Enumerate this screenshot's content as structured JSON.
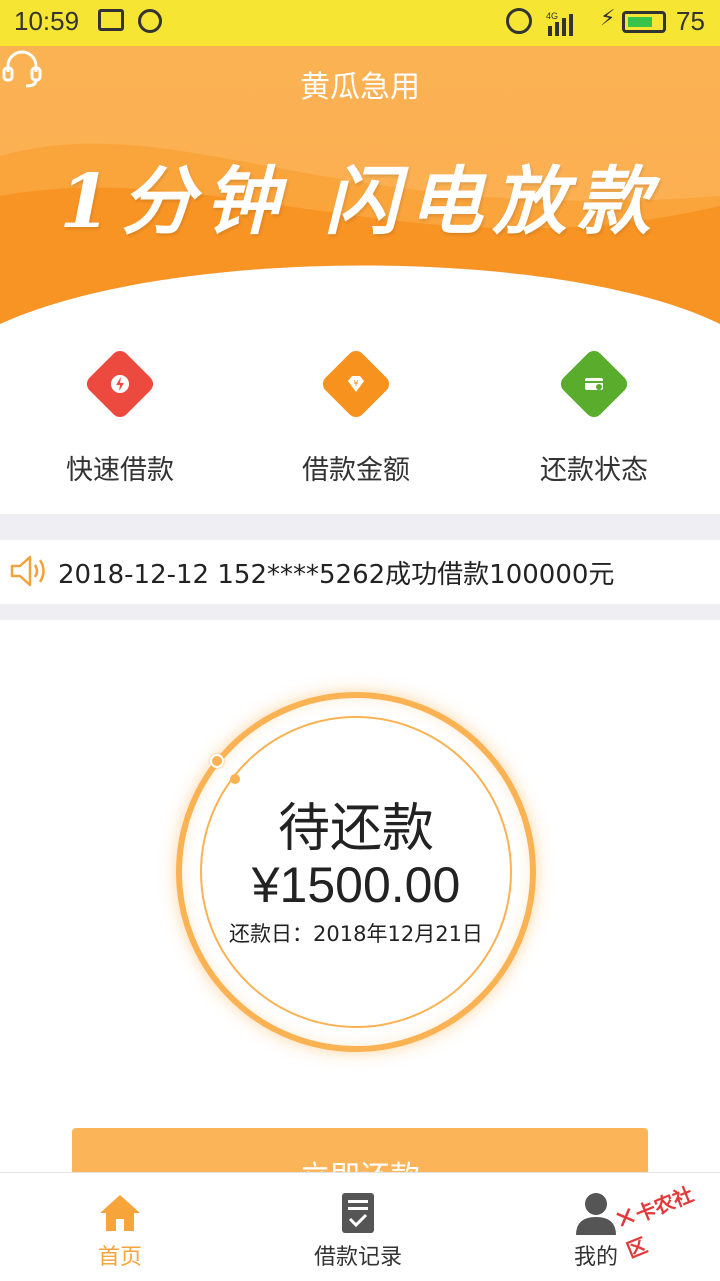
{
  "status_bar": {
    "time": "10:59",
    "network": "4G",
    "battery_percent": "75",
    "battery_level": 0.75,
    "battery_color": "#39c34a",
    "icons": [
      "mail-icon",
      "check-circle-icon",
      "alarm-icon",
      "signal-icon",
      "charging-icon",
      "battery-icon"
    ]
  },
  "header": {
    "title": "黄瓜急用",
    "support_icon": "headset-icon",
    "brand_color": "#fbb253"
  },
  "banner": {
    "slogan": "1分钟 闪电放款"
  },
  "features": [
    {
      "label": "快速借款",
      "icon": "lightning-icon",
      "color": "#ec4a3e"
    },
    {
      "label": "借款金额",
      "icon": "diamond-yen-icon",
      "color": "#f7921e"
    },
    {
      "label": "还款状态",
      "icon": "card-check-icon",
      "color": "#5aac2d"
    }
  ],
  "notice": {
    "icon": "speaker-icon",
    "text": "2018-12-12 152****5262成功借款100000元"
  },
  "loan_card": {
    "status_label": "待还款",
    "amount": "¥1500.00",
    "due_date": "还款日：2018年12月21日"
  },
  "repay_button": {
    "label": "立即还款"
  },
  "tabbar": {
    "items": [
      {
        "label": "首页",
        "icon": "home-icon",
        "active": true
      },
      {
        "label": "借款记录",
        "icon": "record-icon",
        "active": false
      },
      {
        "label": "我的",
        "icon": "user-icon",
        "active": false
      }
    ],
    "active_color": "#f7a43a"
  },
  "watermark": {
    "text": "卡农社区"
  }
}
